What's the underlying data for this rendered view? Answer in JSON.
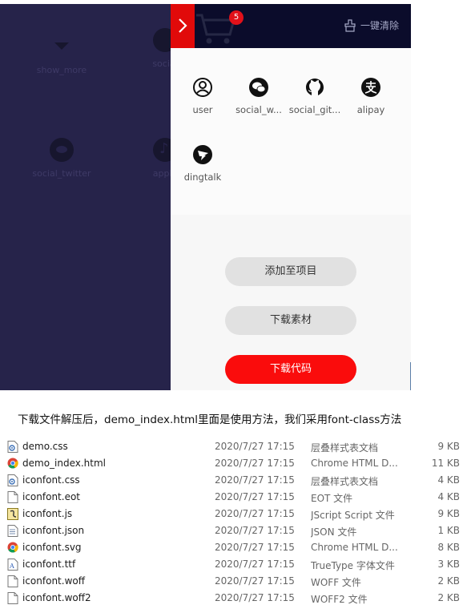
{
  "background_icons": [
    {
      "label": "show_more",
      "icon": "triangle-down-icon"
    },
    {
      "label": "social",
      "icon": "social-icon"
    },
    {
      "label": "social_twitter",
      "icon": "twitter-icon"
    },
    {
      "label": "apple",
      "icon": "music-note-icon"
    }
  ],
  "panel": {
    "cart_count": "5",
    "clear_label": "一键清除",
    "icons": [
      {
        "label": "user",
        "icon": "user-icon"
      },
      {
        "label": "social_w...",
        "icon": "wechat-icon"
      },
      {
        "label": "social_git...",
        "icon": "github-icon"
      },
      {
        "label": "alipay",
        "icon": "alipay-icon"
      },
      {
        "label": "dingtalk",
        "icon": "dingtalk-icon"
      }
    ],
    "buttons": {
      "add_to_project": "添加至项目",
      "download_assets": "下载素材",
      "download_code": "下载代码"
    }
  },
  "caption": "下载文件解压后，demo_index.html里面是使用方法，我们采用font-class方法",
  "files": [
    {
      "name": "demo.css",
      "date": "2020/7/27 17:15",
      "type": "层叠样式表文档",
      "size": "9 KB",
      "icon": "css-file-icon"
    },
    {
      "name": "demo_index.html",
      "date": "2020/7/27 17:15",
      "type": "Chrome HTML D...",
      "size": "11 KB",
      "icon": "chrome-icon"
    },
    {
      "name": "iconfont.css",
      "date": "2020/7/27 17:15",
      "type": "层叠样式表文档",
      "size": "4 KB",
      "icon": "css-file-icon"
    },
    {
      "name": "iconfont.eot",
      "date": "2020/7/27 17:15",
      "type": "EOT 文件",
      "size": "4 KB",
      "icon": "blank-file-icon"
    },
    {
      "name": "iconfont.js",
      "date": "2020/7/27 17:15",
      "type": "JScript Script 文件",
      "size": "9 KB",
      "icon": "script-file-icon"
    },
    {
      "name": "iconfont.json",
      "date": "2020/7/27 17:15",
      "type": "JSON 文件",
      "size": "1 KB",
      "icon": "json-file-icon"
    },
    {
      "name": "iconfont.svg",
      "date": "2020/7/27 17:15",
      "type": "Chrome HTML D...",
      "size": "8 KB",
      "icon": "chrome-icon"
    },
    {
      "name": "iconfont.ttf",
      "date": "2020/7/27 17:15",
      "type": "TrueType 字体文件",
      "size": "3 KB",
      "icon": "font-file-icon"
    },
    {
      "name": "iconfont.woff",
      "date": "2020/7/27 17:15",
      "type": "WOFF 文件",
      "size": "2 KB",
      "icon": "blank-file-icon"
    },
    {
      "name": "iconfont.woff2",
      "date": "2020/7/27 17:15",
      "type": "WOFF2 文件",
      "size": "2 KB",
      "icon": "blank-file-icon"
    }
  ],
  "colors": {
    "overlay": "#26234a",
    "header": "#0b0c2b",
    "accent_red": "#e10a0a",
    "badge": "#e2111a"
  }
}
